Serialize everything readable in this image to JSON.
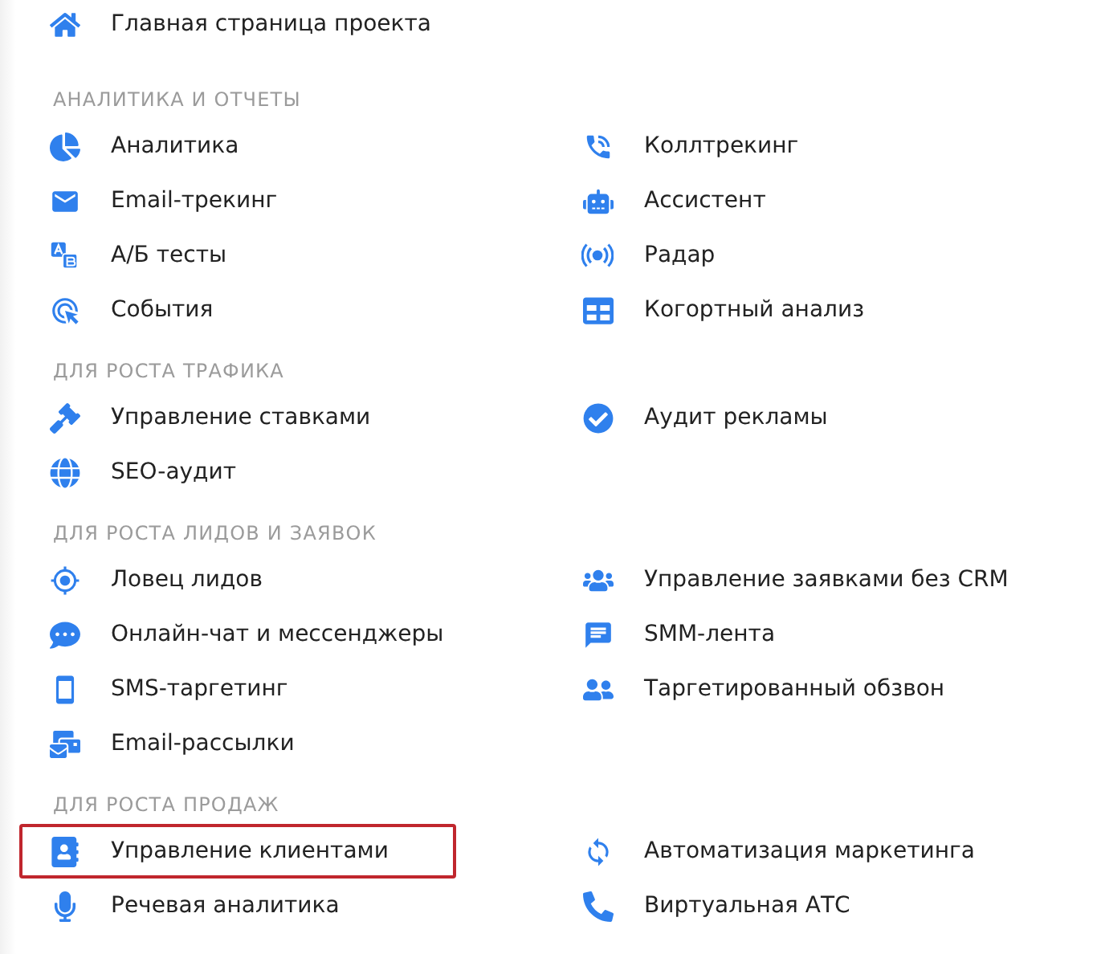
{
  "home": {
    "label": "Главная страница проекта",
    "highlighted": false
  },
  "sections": [
    {
      "title": "АНАЛИТИКА И ОТЧЕТЫ",
      "columns": [
        {
          "items": [
            {
              "label": "Аналитика",
              "highlighted": false
            },
            {
              "label": "Email-трекинг",
              "highlighted": false
            },
            {
              "label": "А/Б тесты",
              "highlighted": false
            },
            {
              "label": "События",
              "highlighted": false
            }
          ]
        },
        {
          "items": [
            {
              "label": "Коллтрекинг",
              "highlighted": false
            },
            {
              "label": "Ассистент",
              "highlighted": false
            },
            {
              "label": "Радар",
              "highlighted": false
            },
            {
              "label": "Когортный анализ",
              "highlighted": false
            }
          ]
        }
      ]
    },
    {
      "title": "ДЛЯ РОСТА ТРАФИКА",
      "columns": [
        {
          "items": [
            {
              "label": "Управление ставками",
              "highlighted": false
            },
            {
              "label": "SEO-аудит",
              "highlighted": false
            }
          ]
        },
        {
          "items": [
            {
              "label": "Аудит рекламы",
              "highlighted": false
            }
          ]
        }
      ]
    },
    {
      "title": "ДЛЯ РОСТА ЛИДОВ И ЗАЯВОК",
      "columns": [
        {
          "items": [
            {
              "label": "Ловец лидов",
              "highlighted": false
            },
            {
              "label": "Онлайн-чат и мессенджеры",
              "highlighted": false
            },
            {
              "label": "SMS-таргетинг",
              "highlighted": false
            },
            {
              "label": "Email-рассылки",
              "highlighted": false
            }
          ]
        },
        {
          "items": [
            {
              "label": "Управление заявками без CRM",
              "highlighted": false
            },
            {
              "label": "SMM-лента",
              "highlighted": false
            },
            {
              "label": "Таргетированный обзвон",
              "highlighted": false
            }
          ]
        }
      ]
    },
    {
      "title": "ДЛЯ РОСТА ПРОДАЖ",
      "columns": [
        {
          "items": [
            {
              "label": "Управление клиентами",
              "highlighted": true
            },
            {
              "label": "Речевая аналитика",
              "highlighted": false
            }
          ]
        },
        {
          "items": [
            {
              "label": "Автоматизация маркетинга",
              "highlighted": false
            },
            {
              "label": "Виртуальная АТС",
              "highlighted": false
            }
          ]
        }
      ]
    }
  ]
}
